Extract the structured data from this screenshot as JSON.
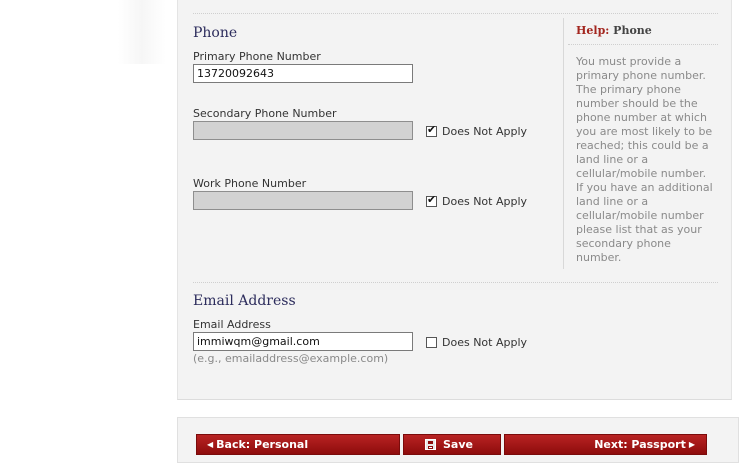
{
  "phone_section": {
    "title": "Phone",
    "primary": {
      "label": "Primary Phone Number",
      "value": "13720092643"
    },
    "secondary": {
      "label": "Secondary Phone Number",
      "value": "",
      "does_not_apply_label": "Does Not Apply",
      "does_not_apply_checked": true
    },
    "work": {
      "label": "Work Phone Number",
      "value": "",
      "does_not_apply_label": "Does Not Apply",
      "does_not_apply_checked": true
    }
  },
  "email_section": {
    "title": "Email Address",
    "label": "Email Address",
    "value": "immiwqm@gmail.com",
    "does_not_apply_label": "Does Not Apply",
    "does_not_apply_checked": false,
    "hint": "(e.g., emailaddress@example.com)"
  },
  "help": {
    "prefix": "Help:",
    "topic": "Phone",
    "body": "You must provide a primary phone number. The primary phone number should be the phone number at which you are most likely to be reached; this could be a land line or a cellular/mobile number. If you have an additional land line or a cellular/mobile number please list that as your secondary phone number."
  },
  "buttons": {
    "back": "Back: Personal",
    "save": "Save",
    "next": "Next: Passport"
  },
  "colors": {
    "accent_red": "#a3261f",
    "section_title": "#2c2c5c",
    "panel_bg": "#f3f3f3"
  },
  "icons": {
    "back": "arrow-left-icon",
    "save": "save-icon",
    "next": "arrow-right-icon"
  }
}
